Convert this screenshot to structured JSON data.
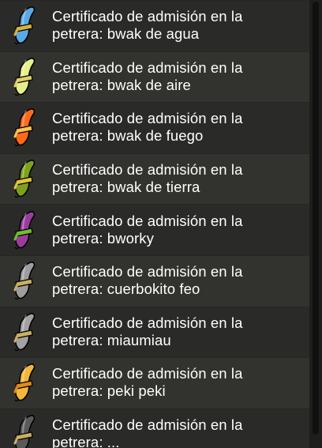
{
  "items": [
    {
      "label": "Certificado de admisión en la\npetrera: bwak de agua",
      "color": "#5aa9e6",
      "band": "#d7b23a",
      "icon": "scroll-icon-blue"
    },
    {
      "label": "Certificado de admisión en la\npetrera: bwak de aire",
      "color": "#e6f08a",
      "band": "#e2cf6a",
      "icon": "scroll-icon-yellow-green"
    },
    {
      "label": "Certificado de admisión en la\npetrera: bwak de fuego",
      "color": "#ff6a1a",
      "band": "#ffc24a",
      "icon": "scroll-icon-orange"
    },
    {
      "label": "Certificado de admisión en la\npetrera: bwak de tierra",
      "color": "#7ea01d",
      "band": "#e2c43a",
      "icon": "scroll-icon-green"
    },
    {
      "label": "Certificado de admisión en la\npetrera: bworky",
      "color": "#9b3c9d",
      "band": "#6cbf2d",
      "icon": "scroll-icon-purple"
    },
    {
      "label": "Certificado de admisión en la\npetrera: cuerbokito feo",
      "color": "#9d9d9d",
      "band": "#c9b060",
      "icon": "scroll-icon-gray"
    },
    {
      "label": "Certificado de admisión en la\npetrera: miaumiau",
      "color": "#a2a2a2",
      "band": "#c9b060",
      "icon": "scroll-icon-gray"
    },
    {
      "label": "Certificado de admisión en la\npetrera: peki peki",
      "color": "#f2b63b",
      "band": "#e08a1a",
      "icon": "scroll-icon-gold"
    },
    {
      "label": "Certificado de admisión en la\npetrera: ...",
      "color": "#5a5a5a",
      "band": "#c9b060",
      "icon": "scroll-icon-dark"
    }
  ]
}
